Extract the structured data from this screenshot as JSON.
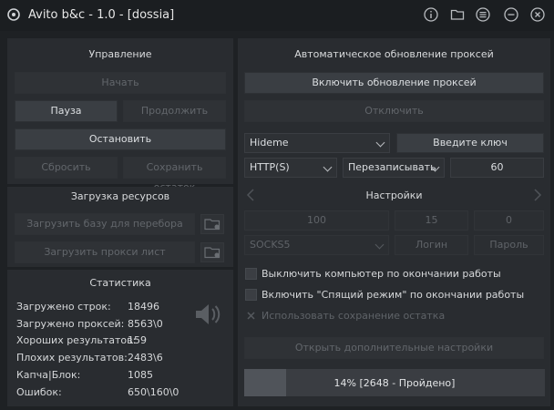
{
  "window": {
    "title": "Avito b&c - 1.0 - [dossia]"
  },
  "left": {
    "control": {
      "title": "Управление",
      "start": "Начать",
      "pause": "Пауза",
      "resume": "Продолжить",
      "stop": "Остановить",
      "reset": "Сбросить",
      "save_rest": "Сохранить остаток"
    },
    "resources": {
      "title": "Загрузка ресурсов",
      "load_base": "Загрузить базу для перебора",
      "load_proxy": "Загрузить прокси лист"
    },
    "stats": {
      "title": "Статистика",
      "rows": [
        {
          "label": "Загружено строк:",
          "value": "18496"
        },
        {
          "label": "Загружено проксей:",
          "value": "8563\\0"
        },
        {
          "label": "Хороших результатов:",
          "value": "159"
        },
        {
          "label": "Плохих результатов:",
          "value": "2483\\6"
        },
        {
          "label": "Капча|Блок:",
          "value": "1085"
        },
        {
          "label": "Ошибок:",
          "value": "650\\160\\0"
        }
      ]
    }
  },
  "right": {
    "proxy": {
      "title": "Автоматическое обновление проксей",
      "enable": "Включить обновление проксей",
      "disable": "Отключить",
      "provider": "Hideme",
      "key_button": "Введите ключ",
      "protocol": "HTTP(S)",
      "mode": "Перезаписывать",
      "interval": "60"
    },
    "settings": {
      "title": "Настройки",
      "threads": "100",
      "timeout": "15",
      "retries": "0",
      "proxy_type": "SOCKS5",
      "login_placeholder": "Логин",
      "password_placeholder": "Пароль",
      "opt_shutdown": "Выключить компьютер по окончании работы",
      "opt_sleep": "Включить \"Спящий режим\" по окончании работы",
      "opt_save_rest": "Использовать сохранение остатка",
      "advanced": "Открыть дополнительные настройки"
    },
    "progress": {
      "text": "14% [2648 - Пройдено]",
      "fraction": 0.14
    }
  }
}
